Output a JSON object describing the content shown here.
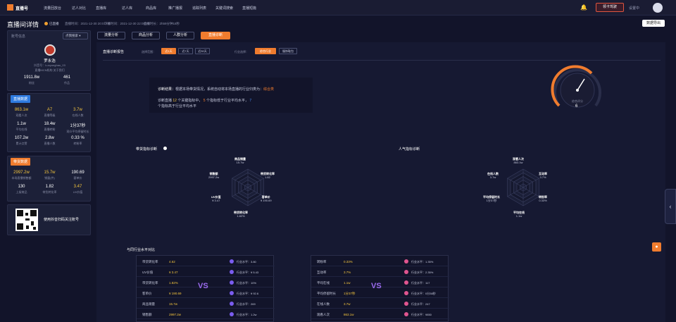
{
  "nav": {
    "logo_text": "直播号",
    "items": [
      "流量回放台",
      "达人对比",
      "直播库",
      "达人库",
      "商品库",
      "推广播报",
      "追踪列表",
      "关键词搜索",
      "直播短篇"
    ],
    "upgrade": "领卡驾驶",
    "settings": "设置中"
  },
  "page": {
    "title": "直播间详情",
    "live_status": "已直播",
    "meta": [
      "直播时间：2021-12-30 20:01:00",
      "下播时间：2021-12-30 22:00:00",
      "直播时长：2h59分钟18秒"
    ],
    "export": "数据导出"
  },
  "account": {
    "label": "账号信息",
    "select": "点我搜索",
    "name": "罗永浩",
    "id": "抖音号：Luoyonghao_03",
    "tag": "直播MCN机构  关于我们",
    "stats": [
      {
        "value": "1911.8w",
        "label": "粉丝"
      },
      {
        "value": "461",
        "label": "作品"
      }
    ]
  },
  "live_data": {
    "title": "直播数据",
    "items": [
      {
        "v": "863.1w",
        "l": "观看人次",
        "c": "yellow"
      },
      {
        "v": "A7",
        "l": "直播等级",
        "c": "yellow"
      },
      {
        "v": "3.7w",
        "l": "在线人数",
        "c": "yellow"
      },
      {
        "v": "1.1w",
        "l": "平均在线",
        "c": "white"
      },
      {
        "v": "18.4w",
        "l": "直播转粉",
        "c": "white"
      },
      {
        "v": "1分37秒",
        "l": "观众平均停留时长",
        "c": "white"
      },
      {
        "v": "107.2w",
        "l": "累计点赞",
        "c": "white"
      },
      {
        "v": "2.8w",
        "l": "直播人数",
        "c": "white"
      },
      {
        "v": "0.33 %",
        "l": "转粉率",
        "c": "white"
      }
    ]
  },
  "sales_data": {
    "title": "带货数据",
    "items": [
      {
        "v": "2997.2w",
        "l": "本场直播销售额",
        "c": "yellow"
      },
      {
        "v": "15.7w",
        "l": "销量(件)",
        "c": "yellow"
      },
      {
        "v": "190.69",
        "l": "客单价",
        "c": "white"
      },
      {
        "v": "130",
        "l": "上架商品",
        "c": "white"
      },
      {
        "v": "1.82",
        "l": "带货转化率",
        "c": "white"
      },
      {
        "v": "3.47",
        "l": "UV价值",
        "c": "yellow"
      }
    ]
  },
  "qr": {
    "text": "使用抖音扫码关注账号"
  },
  "tabs": [
    "流量分析",
    "商品分析",
    "人群分析",
    "直播诊断"
  ],
  "filters": {
    "title": "直播诊断报告",
    "range_label": "选择范围：",
    "range": [
      "近1天",
      "近7天",
      "近30天"
    ],
    "industry_label": "行业选择：",
    "industry": [
      "综合行业",
      "服饰鞋包"
    ]
  },
  "diagnosis": {
    "conclusion_label": "诊断结果：",
    "conclusion_text": "根据本场带货情况，系统自动将本场直播的行业归类为：",
    "industry": "综合类",
    "line2a": "诊断直播",
    "n_total": "12",
    "line2b": "个关键指标中，",
    "n_low": "5",
    "line2c": "个指标低于行业平均水平，",
    "n_high": "7",
    "line2d": "个指标高于行业平均水平",
    "gauge_label": "综合评分",
    "gauge_value": "6"
  },
  "radar_left": {
    "title": "带货指标诊断",
    "labels": [
      {
        "n": "商品销量",
        "v": "15.7w"
      },
      {
        "n": "带货转化率",
        "v": "1.82"
      },
      {
        "n": "客单价",
        "v": "¥ 190.69"
      },
      {
        "n": "带货转化率",
        "v": "1.82%"
      },
      {
        "n": "UV价值",
        "v": "¥ 3.47"
      },
      {
        "n": "销售额",
        "v": "2997.2w"
      }
    ]
  },
  "radar_right": {
    "title": "人气指标诊断",
    "labels": [
      {
        "n": "观看人次",
        "v": "863.1w"
      },
      {
        "n": "互动率",
        "v": "3.7%"
      },
      {
        "n": "转粉率",
        "v": "0.33%"
      },
      {
        "n": "平均在线",
        "v": "1.1w"
      },
      {
        "n": "平均停留时长",
        "v": "1分37秒"
      },
      {
        "n": "在线人数",
        "v": "3.7w"
      }
    ]
  },
  "compare": {
    "title": "与同行业水平对比",
    "vs": "VS",
    "left": [
      {
        "n": "带货转化率",
        "v": "4.62",
        "b": "#7a5cf0",
        "iv": "行业水平：3.80"
      },
      {
        "n": "UV价值",
        "v": "¥ 3.47",
        "b": "#7a5cf0",
        "iv": "行业水平：¥ 5.43"
      },
      {
        "n": "带货转化率",
        "v": "1.82%",
        "b": "#7a5cf0",
        "iv": "行业水平：10%"
      },
      {
        "n": "客单价",
        "v": "¥ 190.69",
        "b": "#7a5cf0",
        "iv": "行业水平：¥ 92.6"
      },
      {
        "n": "商品销量",
        "v": "15.7w",
        "b": "#7a5cf0",
        "iv": "行业水平：269"
      },
      {
        "n": "销售额",
        "v": "2997.2w",
        "b": "#7a5cf0",
        "iv": "行业水平：1.2w"
      }
    ],
    "right": [
      {
        "n": "转粉率",
        "v": "0.33%",
        "b": "#e0558f",
        "iv": "行业水平：1.35%"
      },
      {
        "n": "互动率",
        "v": "3.7%",
        "b": "#e0558f",
        "iv": "行业水平：2.35%"
      },
      {
        "n": "平均在线",
        "v": "1.1w",
        "b": "#e0558f",
        "iv": "行业水平：117"
      },
      {
        "n": "平均停留时长",
        "v": "1分37秒",
        "b": "#e0558f",
        "iv": "行业水平：0分38秒"
      },
      {
        "n": "在线人数",
        "v": "3.7w",
        "b": "#e0558f",
        "iv": "行业水平：247"
      },
      {
        "n": "观看人次",
        "v": "863.1w",
        "b": "#e0558f",
        "iv": "行业水平：9850"
      }
    ]
  }
}
